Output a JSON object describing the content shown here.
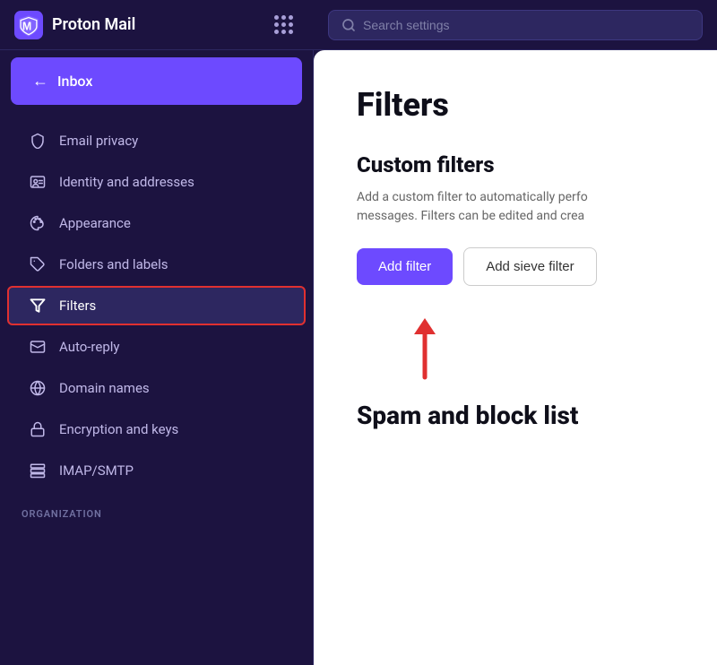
{
  "header": {
    "logo_text": "Proton Mail",
    "search_placeholder": "Search settings"
  },
  "sidebar": {
    "inbox_label": "Inbox",
    "nav_items": [
      {
        "id": "email-privacy",
        "label": "Email privacy",
        "icon": "shield"
      },
      {
        "id": "identity-addresses",
        "label": "Identity and addresses",
        "icon": "identity"
      },
      {
        "id": "appearance",
        "label": "Appearance",
        "icon": "appearance"
      },
      {
        "id": "folders-labels",
        "label": "Folders and labels",
        "icon": "tag"
      },
      {
        "id": "filters",
        "label": "Filters",
        "icon": "filter",
        "active": true
      },
      {
        "id": "auto-reply",
        "label": "Auto-reply",
        "icon": "autoreply"
      },
      {
        "id": "domain-names",
        "label": "Domain names",
        "icon": "domain"
      },
      {
        "id": "encryption-keys",
        "label": "Encryption and keys",
        "icon": "lock"
      },
      {
        "id": "imap-smtp",
        "label": "IMAP/SMTP",
        "icon": "server"
      }
    ],
    "section_labels": [
      {
        "id": "organization",
        "label": "ORGANIZATION",
        "after_index": 8
      }
    ]
  },
  "content": {
    "page_title": "Filters",
    "custom_filters": {
      "title": "Custom filters",
      "description": "Add a custom filter to automatically perfo\nmessages. Filters can be edited and crea",
      "add_filter_label": "Add filter",
      "add_sieve_label": "Add sieve filter"
    },
    "spam_section": {
      "title": "Spam and block list"
    }
  }
}
